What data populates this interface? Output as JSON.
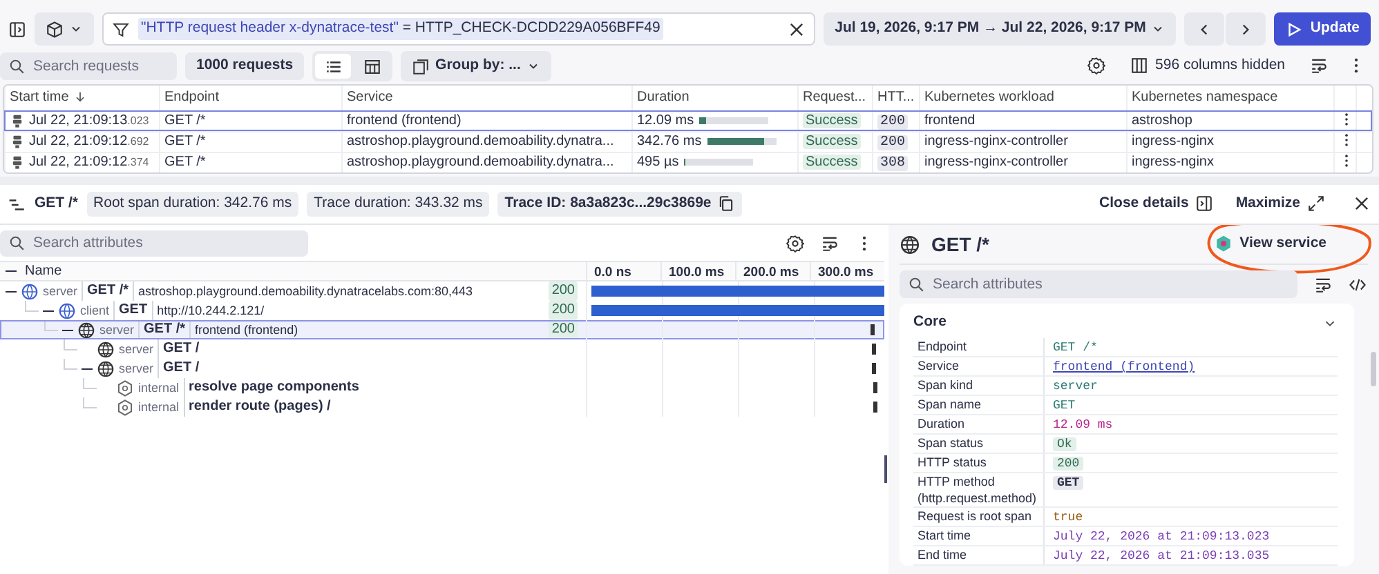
{
  "filter_bar": {
    "filter_key": "\"HTTP request header x-dynatrace-test\"",
    "filter_operator": "=",
    "filter_value": "HTTP_CHECK-DCDD229A056BFF49",
    "time_range": "Jul 19, 2026, 9:17 PM → Jul 22, 2026, 9:17 PM",
    "update_button": "Update"
  },
  "toolbar": {
    "search_placeholder": "Search requests",
    "request_count": "1000 requests",
    "views": [
      {
        "kind": "list",
        "selected": true
      },
      {
        "kind": "table",
        "selected": false
      }
    ],
    "group_by": "Group by: ...",
    "columns_hidden": "596 columns hidden"
  },
  "requests_table": {
    "columns": [
      "Start time",
      "Endpoint",
      "Service",
      "Duration",
      "Request...",
      "HTT...",
      "Kubernetes workload",
      "Kubernetes namespace"
    ],
    "rows": [
      {
        "selected": true,
        "start_time": "Jul 22, 21:09:13",
        "start_ms": ".023",
        "endpoint": "GET /*",
        "service": "frontend (frontend)",
        "duration": "12.09 ms",
        "level": 0.09,
        "request_status": "Success",
        "http_status": "200",
        "workload": "frontend",
        "namespace": "astroshop"
      },
      {
        "selected": false,
        "start_time": "Jul 22, 21:09:12",
        "start_ms": ".692",
        "endpoint": "GET /*",
        "service": "astroshop.playground.demoability.dynatra...",
        "duration": "342.76 ms",
        "level": 0.83,
        "request_status": "Success",
        "http_status": "200",
        "workload": "ingress-nginx-controller",
        "namespace": "ingress-nginx"
      },
      {
        "selected": false,
        "start_time": "Jul 22, 21:09:12",
        "start_ms": ".374",
        "endpoint": "GET /*",
        "service": "astroshop.playground.demoability.dynatra...",
        "duration": "495 µs",
        "level": 0.01,
        "request_status": "Success",
        "http_status": "308",
        "workload": "ingress-nginx-controller",
        "namespace": "ingress-nginx"
      }
    ]
  },
  "trace_header": {
    "title": "GET /*",
    "chips": [
      "Root span duration: 342.76 ms",
      "Trace duration: 343.32 ms"
    ],
    "trace_id": "Trace ID: 8a3a823c...29c3869e",
    "close_details": "Close details",
    "maximize": "Maximize"
  },
  "span_tree": {
    "search_placeholder": "Search attributes",
    "name_header": "Name",
    "ticks": [
      "0.0 ns",
      "100.0 ms",
      "200.0 ms",
      "300.0 ms"
    ],
    "spans": [
      {
        "kind": "server",
        "name": "GET /*",
        "detail": "astroshop.playground.demoability.dynatracelabs.com:80,443",
        "status": "200",
        "marker": false,
        "level": 1.0,
        "selected": false,
        "expanded": true,
        "children": [
          {
            "kind": "client",
            "name": "GET",
            "detail": "http://10.244.2.121/",
            "status": "200",
            "marker": false,
            "level": 1.0,
            "selected": false,
            "expanded": true,
            "children": [
              {
                "kind": "server",
                "name": "GET /*",
                "detail": "frontend (frontend)",
                "status": "200",
                "marker": true,
                "level": 0.97,
                "selected": true,
                "expanded": true,
                "children": [
                  {
                    "kind": "server",
                    "name": "GET /",
                    "marker": true,
                    "level": 0.975,
                    "selected": false,
                    "expanded": false
                  },
                  {
                    "kind": "server",
                    "name": "GET /",
                    "marker": true,
                    "level": 0.975,
                    "selected": false,
                    "expanded": true,
                    "children": [
                      {
                        "kind": "internal",
                        "name": "resolve page components",
                        "marker": true,
                        "level": 0.98,
                        "selected": false,
                        "expanded": false
                      },
                      {
                        "kind": "internal",
                        "name": "render route (pages) /",
                        "marker": true,
                        "level": 0.98,
                        "selected": false,
                        "expanded": false
                      }
                    ]
                  }
                ]
              }
            ]
          }
        ]
      }
    ]
  },
  "details": {
    "title": "GET /*",
    "view_service": "View service",
    "search_placeholder": "Search attributes",
    "section": {
      "title": "Core",
      "expanded": true,
      "attributes": [
        {
          "label": "Endpoint",
          "value": "GET /*",
          "kind": "code"
        },
        {
          "label": "Service",
          "value": "frontend (frontend)",
          "kind": "link"
        },
        {
          "label": "Span kind",
          "value": "server",
          "kind": "code"
        },
        {
          "label": "Span name",
          "value": "GET",
          "kind": "code"
        },
        {
          "label": "Duration",
          "value": "12.09 ms",
          "kind": "number"
        },
        {
          "label": "Span status",
          "value": "Ok",
          "kind": "badge"
        },
        {
          "label": "HTTP status",
          "value": "200",
          "kind": "badge"
        },
        {
          "label": "HTTP method",
          "sublabel": "(http.request.method)",
          "value": "GET",
          "kind": "tag"
        },
        {
          "label": "Request is root span",
          "value": "true",
          "kind": "bool"
        },
        {
          "label": "Start time",
          "value": "July 22, 2026 at 21:09:13.023",
          "kind": "time"
        },
        {
          "label": "End time",
          "value": "July 22, 2026 at 21:09:13.035",
          "kind": "time"
        }
      ]
    }
  }
}
